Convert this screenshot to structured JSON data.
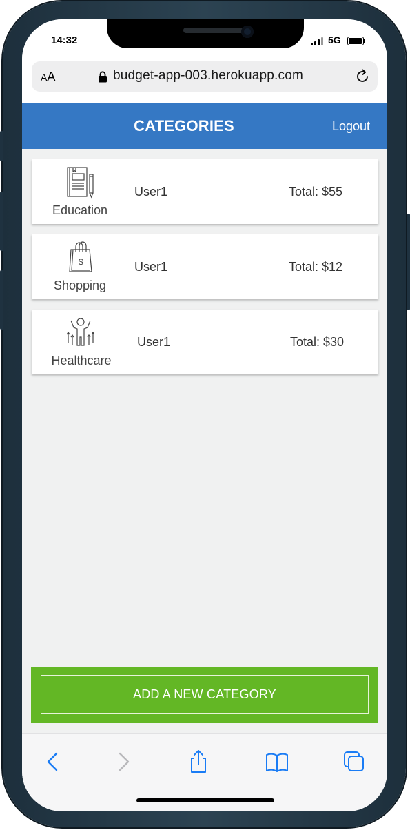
{
  "status_bar": {
    "time": "14:32",
    "network": "5G"
  },
  "browser": {
    "text_size_label_large": "A",
    "text_size_label_small": "A",
    "url": "budget-app-003.herokuapp.com",
    "icons": {
      "lock": "lock-icon",
      "reload": "reload-icon"
    }
  },
  "header": {
    "title": "CATEGORIES",
    "logout_label": "Logout",
    "background": "#3578c4"
  },
  "categories": [
    {
      "name": "Education",
      "user": "User1",
      "total": "Total: $55",
      "icon": "book-pencil-icon"
    },
    {
      "name": "Shopping",
      "user": "User1",
      "total": "Total: $12",
      "icon": "shopping-bag-icon"
    },
    {
      "name": "Healthcare",
      "user": "User1",
      "total": "Total: $30",
      "icon": "person-arrows-icon"
    }
  ],
  "add_button": {
    "label": "ADD A NEW CATEGORY",
    "background": "#63b725"
  },
  "toolbar": {
    "icons": [
      "back-icon",
      "forward-icon",
      "share-icon",
      "bookmarks-icon",
      "tabs-icon"
    ],
    "accent": "#1a7cf5"
  }
}
